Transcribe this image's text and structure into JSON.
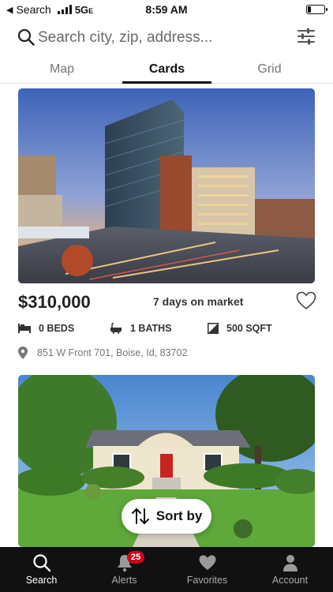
{
  "status_bar": {
    "back_label": "Search",
    "network": "5G",
    "network_suffix": "E",
    "time": "8:59 AM",
    "battery_level": 0.2
  },
  "search": {
    "placeholder": "Search city, zip, address..."
  },
  "tabs": [
    {
      "label": "Map",
      "active": false
    },
    {
      "label": "Cards",
      "active": true
    },
    {
      "label": "Grid",
      "active": false
    }
  ],
  "listings": [
    {
      "price": "$310,000",
      "days_on_market": "7 days on market",
      "beds": "0 BEDS",
      "baths": "1 BATHS",
      "sqft": "500 SQFT",
      "address": "851 W Front 701, Boise, Id, 83702"
    },
    {
      "price": "",
      "days_on_market": ""
    }
  ],
  "sort": {
    "label": "Sort by"
  },
  "bottom_nav": [
    {
      "label": "Search",
      "icon": "search-icon",
      "active": true
    },
    {
      "label": "Alerts",
      "icon": "bell-icon",
      "badge": "25",
      "active": false
    },
    {
      "label": "Favorites",
      "icon": "heart-icon",
      "active": false
    },
    {
      "label": "Account",
      "icon": "person-icon",
      "active": false
    }
  ],
  "colors": {
    "accent": "#111111",
    "badge": "#d0021b",
    "nav_bg": "#111111"
  }
}
